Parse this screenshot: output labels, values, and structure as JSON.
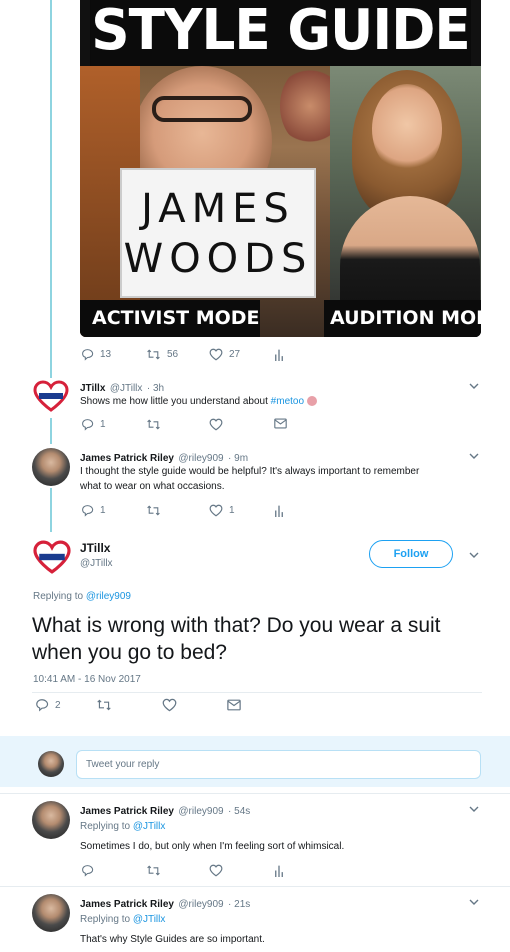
{
  "media": {
    "title": "STYLE GUIDE",
    "sign_line1": "JAMES",
    "sign_line2": "WOODS",
    "left_caption": "ACTIVIST MODE",
    "right_caption": "AUDITION MODE"
  },
  "tweet_parent": {
    "replies": "13",
    "retweets": "56",
    "likes": "27"
  },
  "reply1": {
    "name": "JTillx",
    "handle": "@JTillx",
    "time": "· 3h",
    "text_prefix": "Shows me how little you understand about ",
    "hashtag": "#metoo",
    "replies": "1"
  },
  "reply2": {
    "name": "James Patrick Riley",
    "handle": "@riley909",
    "time": "· 9m",
    "text_line1": "I thought the style guide would be helpful?  It's always important to remember",
    "text_line2": "what to wear on what occasions.",
    "replies": "1",
    "likes": "1"
  },
  "main_tweet": {
    "name": "JTillx",
    "handle": "@JTillx",
    "follow_label": "Follow",
    "replying_prefix": "Replying to ",
    "replying_handle": "@riley909",
    "text": "What is wrong with that? Do you wear a suit when you go to bed?",
    "timestamp": "10:41 AM - 16 Nov 2017",
    "replies": "2"
  },
  "compose": {
    "placeholder": "Tweet your reply"
  },
  "reply3": {
    "name": "James Patrick Riley",
    "handle": "@riley909",
    "time": "· 54s",
    "replying_prefix": "Replying to ",
    "replying_handle": "@JTillx",
    "text": "Sometimes I do, but only when I'm feeling sort of whimsical."
  },
  "reply4": {
    "name": "James Patrick Riley",
    "handle": "@riley909",
    "time": "· 21s",
    "replying_prefix": "Replying to ",
    "replying_handle": "@JTillx",
    "text": "That's why Style Guides are so important."
  },
  "colors": {
    "accent": "#1da1f2",
    "link": "#1b95e0",
    "thread_line": "#8ed4e0",
    "secondary_text": "#657786"
  }
}
